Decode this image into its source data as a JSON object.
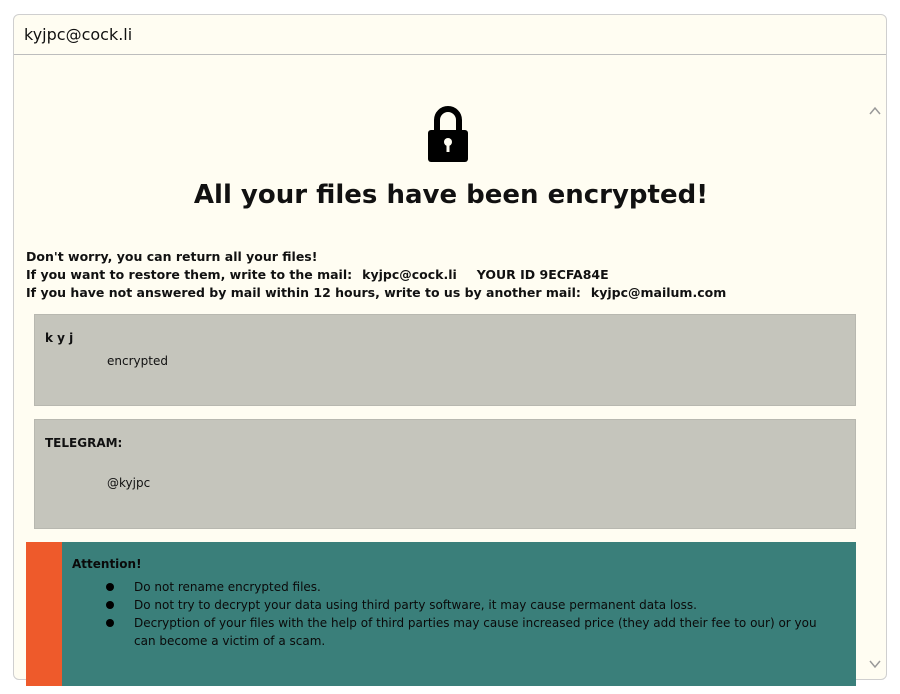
{
  "window": {
    "title": "kyjpc@cock.li"
  },
  "icons": {
    "lock": "lock-icon",
    "scroll_up": "chevron-up-icon",
    "scroll_down": "chevron-down-icon"
  },
  "main": {
    "headline": "All your files have been encrypted!",
    "info_line1": "Don't worry, you can return all your files!",
    "info_line2_prefix": "If you want to restore them, write to the mail:",
    "info_line2_email": "kyjpc@cock.li",
    "info_line2_id": "YOUR ID 9ECFA84E",
    "info_line3_prefix": "If you have not answered by mail within 12 hours, write to us by another mail:",
    "info_line3_email": "kyjpc@mailum.com"
  },
  "box1": {
    "title": "k y j",
    "text": "encrypted"
  },
  "box2": {
    "title": "TELEGRAM:",
    "text": "@kyjpc"
  },
  "attention": {
    "title": "Attention!",
    "items": [
      "Do not rename encrypted files.",
      "Do not try to decrypt your data using third party software, it may cause permanent data loss.",
      "Decryption of your files with the help of third parties may cause increased price (they add their fee to our) or you can become a victim of a scam."
    ]
  },
  "colors": {
    "background": "#fffdf2",
    "grey_box": "#c5c5bc",
    "attention_bg": "#3a7f7a",
    "attention_stripe": "#ee5a2b"
  }
}
